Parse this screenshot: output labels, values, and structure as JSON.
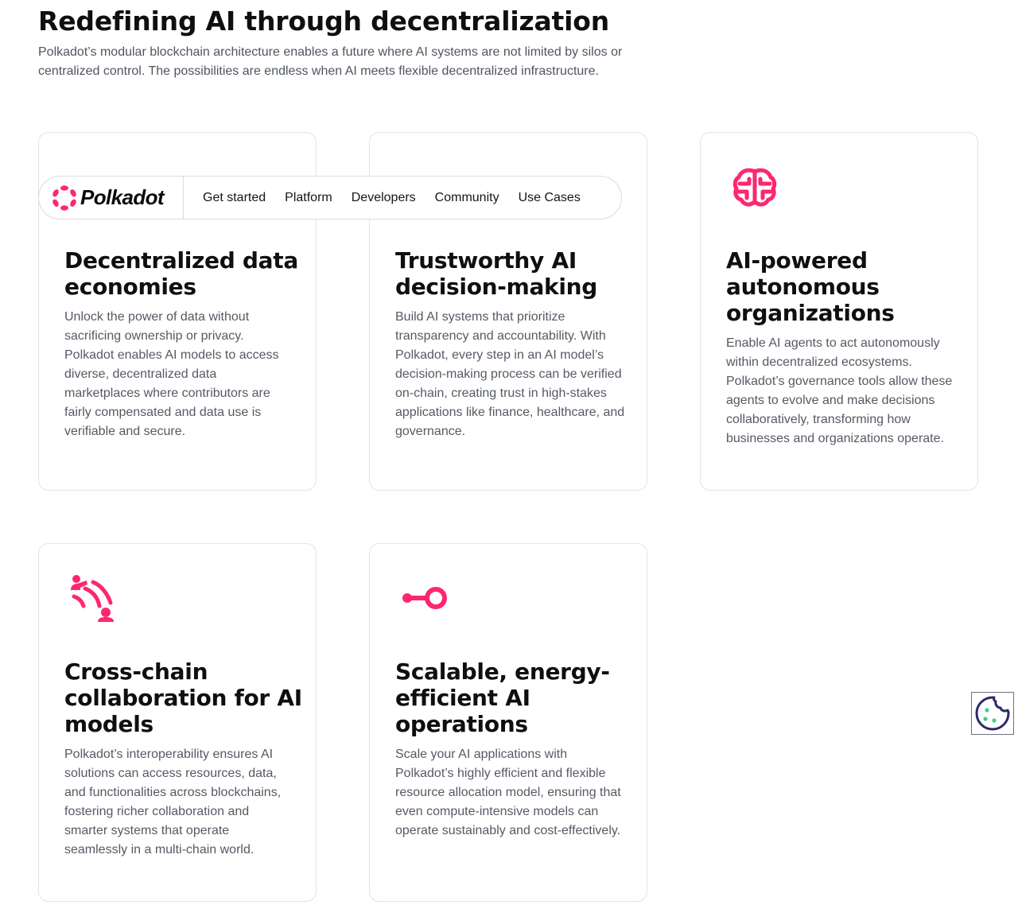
{
  "hero": {
    "title": "Redefining AI through decentralization",
    "description": "Polkadot’s modular blockchain architecture enables a future where AI systems are not limited by silos or centralized control. The possibilities are endless when AI meets flexible decentralized infrastructure."
  },
  "theme": {
    "accent": "#ff2670",
    "cookie_accent": "#2a2968",
    "cookie_dots": "#3ccf93"
  },
  "cards": [
    {
      "icon": "data-lock-icon",
      "title": "Decentralized data economies",
      "text": "Unlock the power of data without sacrificing ownership or privacy. Polkadot enables AI models to access diverse, decentralized data marketplaces where contributors are fairly compensated and data use is verifiable and secure."
    },
    {
      "icon": "shield-icon",
      "title": "Trustworthy AI decision-making",
      "text": "Build AI systems that prioritize transparency and accountability. With Polkadot, every step in an AI model’s decision-making process can be verified on-chain, creating trust in high-stakes applications like finance, healthcare, and governance."
    },
    {
      "icon": "brain-circuit-icon",
      "title": "AI-powered autonomous organizations",
      "text": "Enable AI agents to act autonomously within decentralized ecosystems. Polkadot’s governance tools allow these agents to evolve and make decisions collaboratively, transforming how businesses and organizations operate."
    },
    {
      "icon": "people-signal-icon",
      "title": "Cross-chain collaboration for AI models",
      "text": "Polkadot’s interoperability ensures AI solutions can access resources, data, and functionalities across blockchains, fostering richer collaboration and smarter systems that operate seamlessly in a multi-chain world."
    },
    {
      "icon": "key-node-icon",
      "title": "Scalable, energy-efficient AI operations",
      "text": "Scale your AI applications with Polkadot’s highly efficient and flexible resource allocation model, ensuring that even compute-intensive models can operate sustainably and cost-effectively."
    }
  ],
  "nav": {
    "logo_text": "Polkadot",
    "links": [
      "Get started",
      "Platform",
      "Developers",
      "Community",
      "Use Cases"
    ]
  },
  "cookie": {
    "icon": "cookie-icon"
  }
}
